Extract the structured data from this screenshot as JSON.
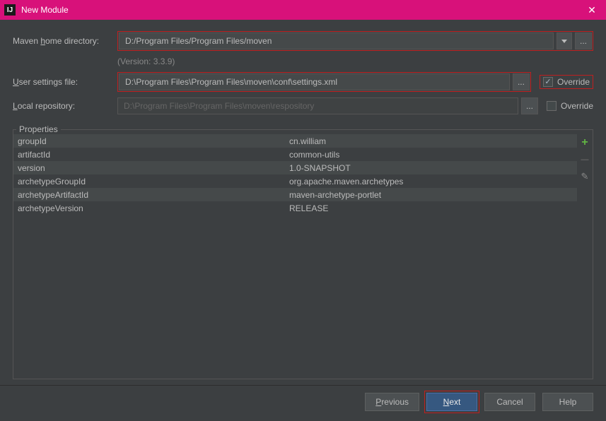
{
  "window": {
    "title": "New Module"
  },
  "labels": {
    "maven_home": "Maven home directory:",
    "version_text": "(Version: 3.3.9)",
    "user_settings": "User settings file:",
    "local_repo": "Local repository:",
    "override": "Override",
    "properties": "Properties"
  },
  "fields": {
    "maven_home_value": "D:/Program Files/Program Files/moven",
    "user_settings_value": "D:\\Program Files\\Program Files\\moven\\conf\\settings.xml",
    "local_repo_value": "D:\\Program Files\\Program Files\\moven\\respository"
  },
  "overrides": {
    "user_settings_checked": true,
    "local_repo_checked": false
  },
  "properties": [
    {
      "key": "groupId",
      "value": "cn.william"
    },
    {
      "key": "artifactId",
      "value": "common-utils"
    },
    {
      "key": "version",
      "value": "1.0-SNAPSHOT"
    },
    {
      "key": "archetypeGroupId",
      "value": "org.apache.maven.archetypes"
    },
    {
      "key": "archetypeArtifactId",
      "value": "maven-archetype-portlet"
    },
    {
      "key": "archetypeVersion",
      "value": "RELEASE"
    }
  ],
  "buttons": {
    "previous": "Previous",
    "next": "Next",
    "cancel": "Cancel",
    "help": "Help"
  },
  "icons": {
    "app": "IJ",
    "dots": "...",
    "plus": "+",
    "minus": "—",
    "pencil": "✎",
    "close": "✕"
  }
}
